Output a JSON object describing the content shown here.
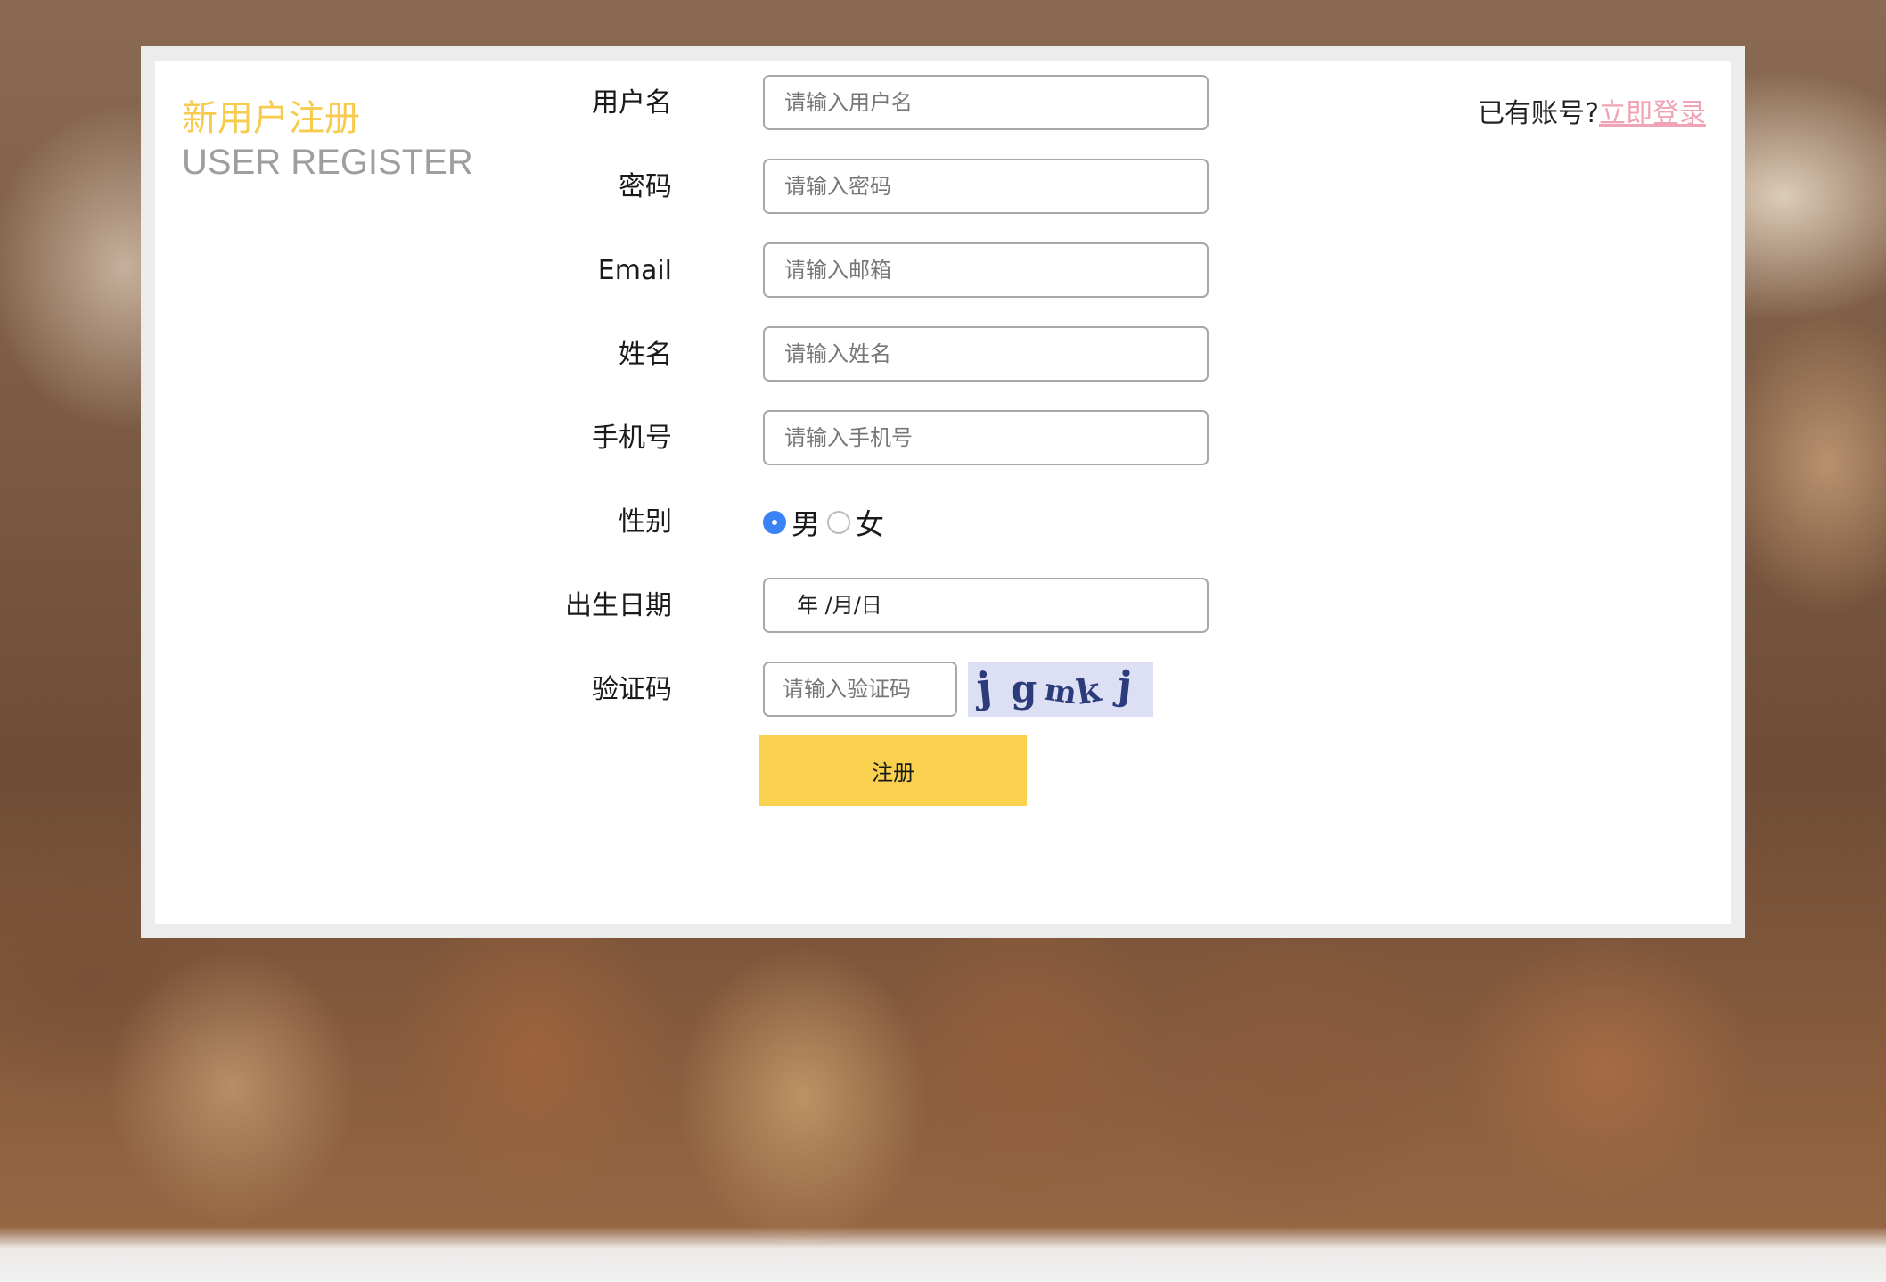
{
  "header": {
    "title_cn": "新用户注册",
    "title_en": "USER REGISTER",
    "login_prompt": "已有账号?",
    "login_link": "立即登录"
  },
  "form": {
    "username": {
      "label": "用户名",
      "placeholder": "请输入用户名",
      "value": ""
    },
    "password": {
      "label": "密码",
      "placeholder": "请输入密码",
      "value": ""
    },
    "email": {
      "label": "Email",
      "placeholder": "请输入邮箱",
      "value": ""
    },
    "name": {
      "label": "姓名",
      "placeholder": "请输入姓名",
      "value": ""
    },
    "phone": {
      "label": "手机号",
      "placeholder": "请输入手机号",
      "value": ""
    },
    "gender": {
      "label": "性别",
      "options": [
        "男",
        "女"
      ],
      "selected": "男"
    },
    "birthdate": {
      "label": "出生日期",
      "display": "年 /月/日"
    },
    "captcha": {
      "label": "验证码",
      "placeholder": "请输入验证码",
      "image_text": "jgmkj"
    },
    "submit_label": "注册"
  },
  "colors": {
    "accent_yellow": "#f9d14f",
    "title_yellow": "#f7cb4d",
    "link_pink": "#f0a3b4",
    "radio_blue": "#3b82f6"
  }
}
